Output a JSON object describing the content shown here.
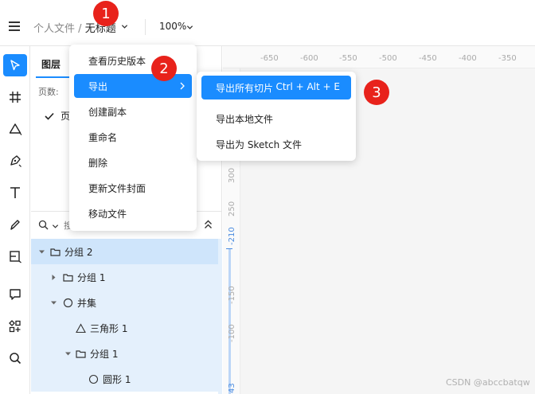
{
  "header": {
    "breadcrumb_parent": "个人文件",
    "breadcrumb_sep": "/",
    "file_title": "无标题",
    "zoom": "100%"
  },
  "toolbar": {
    "tools": [
      "move-icon",
      "frame-icon",
      "shape-icon",
      "pen-icon",
      "text-icon",
      "pencil-icon",
      "slice-icon",
      "comment-icon",
      "components-icon",
      "search-icon"
    ],
    "active_tool": "move-icon"
  },
  "layers_panel": {
    "tab": "图层",
    "pages_label": "页数:",
    "current_page": "页",
    "search_placeholder": "搜",
    "layers": [
      {
        "label": "分组 2"
      },
      {
        "label": "分组 1"
      },
      {
        "label": "并集"
      },
      {
        "label": "三角形 1"
      },
      {
        "label": "分组 1"
      },
      {
        "label": "圆形 1"
      }
    ]
  },
  "canvas": {
    "ruler_h_ticks": [
      "-650",
      "-600",
      "-550",
      "-500",
      "-450",
      "-400",
      "-350"
    ],
    "ruler_v_ticks": [
      "300",
      "250",
      "-210",
      "-150",
      "-100",
      "43"
    ]
  },
  "file_menu": {
    "items": [
      {
        "label": "查看历史版本"
      },
      {
        "label": "导出"
      },
      {
        "label": "创建副本"
      },
      {
        "label": "重命名"
      },
      {
        "label": "删除"
      },
      {
        "label": "更新文件封面"
      },
      {
        "label": "移动文件"
      }
    ]
  },
  "export_submenu": {
    "items": [
      {
        "label": "导出所有切片",
        "shortcut": "Ctrl + Alt + E"
      },
      {
        "label": "导出本地文件"
      },
      {
        "label": "导出为 Sketch 文件"
      }
    ]
  },
  "badges": [
    "1",
    "2",
    "3"
  ],
  "watermark": "CSDN @abccbatqw",
  "colors": {
    "accent": "#1a8cff",
    "badge": "#e8221b",
    "selection": "#cfe5fb"
  }
}
